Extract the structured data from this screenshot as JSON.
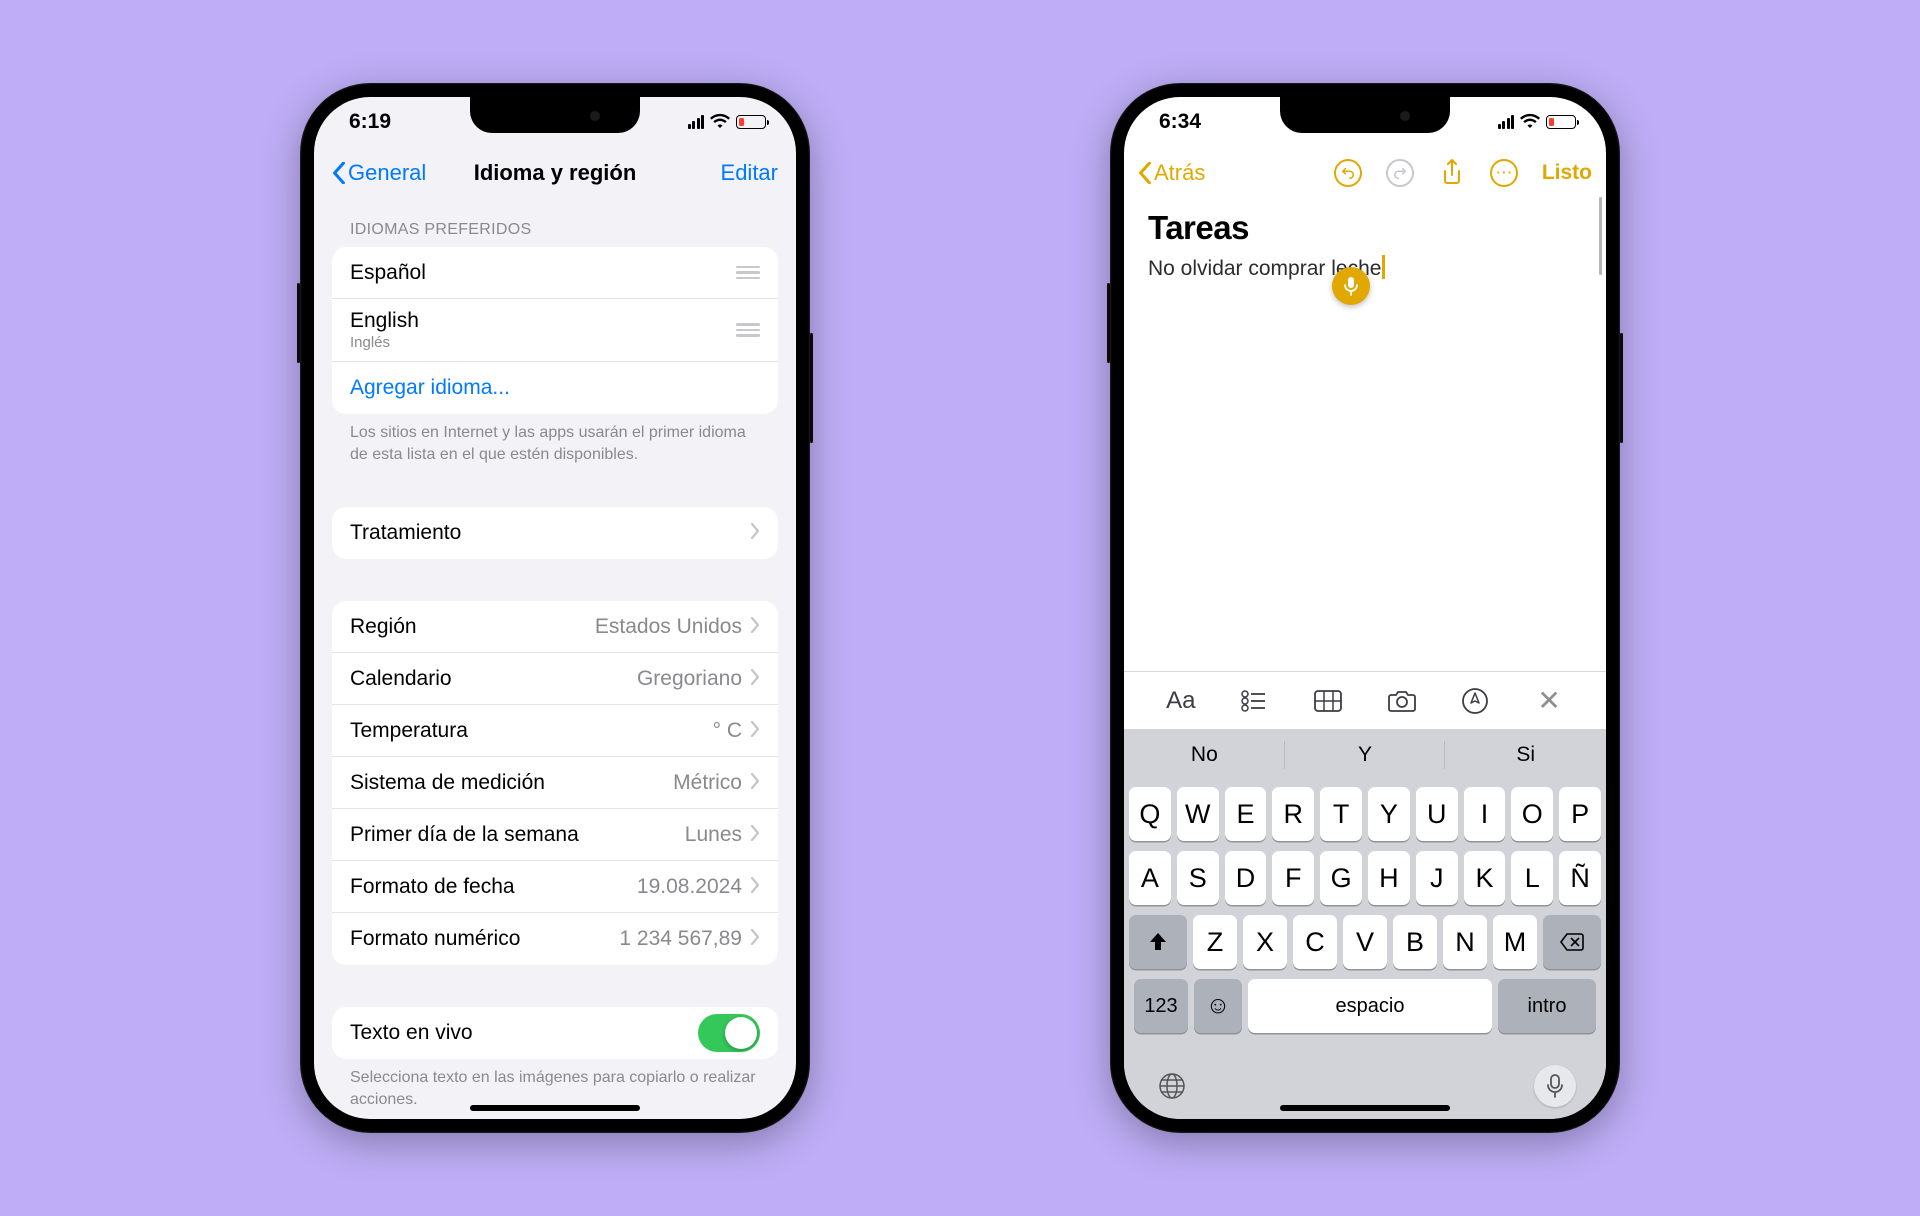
{
  "left": {
    "status": {
      "time": "6:19"
    },
    "nav": {
      "back": "General",
      "title": "Idioma y región",
      "edit": "Editar"
    },
    "section_langs": "Idiomas preferidos",
    "langs": [
      {
        "name": "Español",
        "sub": ""
      },
      {
        "name": "English",
        "sub": "Inglés"
      }
    ],
    "add_lang": "Agregar idioma...",
    "langs_footer": "Los sitios en Internet y las apps usarán el primer idioma de esta lista en el que estén disponibles.",
    "treatment": "Tratamiento",
    "rows": [
      {
        "label": "Región",
        "value": "Estados Unidos"
      },
      {
        "label": "Calendario",
        "value": "Gregoriano"
      },
      {
        "label": "Temperatura",
        "value": "° C"
      },
      {
        "label": "Sistema de medición",
        "value": "Métrico"
      },
      {
        "label": "Primer día de la semana",
        "value": "Lunes"
      },
      {
        "label": "Formato de fecha",
        "value": "19.08.2024"
      },
      {
        "label": "Formato numérico",
        "value": "1 234 567,89"
      }
    ],
    "live_text": "Texto en vivo",
    "live_text_footer": "Selecciona texto en las imágenes para copiarlo o realizar acciones."
  },
  "right": {
    "status": {
      "time": "6:34"
    },
    "nav": {
      "back": "Atrás",
      "done": "Listo"
    },
    "note": {
      "title": "Tareas",
      "body": "No olvidar comprar leche"
    },
    "suggestions": [
      "No",
      "Y",
      "Si"
    ],
    "keys": {
      "r1": [
        "Q",
        "W",
        "E",
        "R",
        "T",
        "Y",
        "U",
        "I",
        "O",
        "P"
      ],
      "r2": [
        "A",
        "S",
        "D",
        "F",
        "G",
        "H",
        "J",
        "K",
        "L",
        "Ñ"
      ],
      "r3": [
        "Z",
        "X",
        "C",
        "V",
        "B",
        "N",
        "M"
      ],
      "num": "123",
      "space": "espacio",
      "enter": "intro"
    }
  }
}
